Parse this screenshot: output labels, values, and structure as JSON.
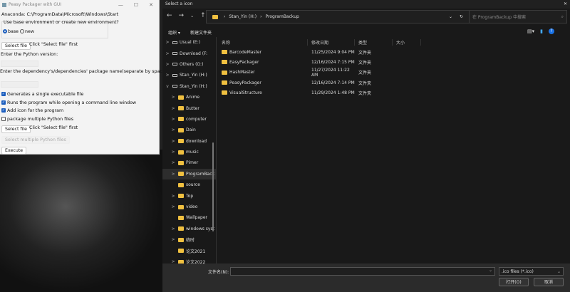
{
  "left_window": {
    "title": "Peasy Packager with GUI",
    "anaconda": "Anaconda: C:\\ProgramData\\Microsoft\\Windows\\Start",
    "env_question": "Use base environment or create new environment?",
    "radio_base": "base",
    "radio_new": "new",
    "select_file": "Select file",
    "select_hint": "Click \"Select file\" first",
    "python_version_label": "Enter the Python version:",
    "deps_label": "Enter the dependency's/dependencies' package name(separate by space):",
    "checks": [
      {
        "label": "Generates a single executable file",
        "checked": true
      },
      {
        "label": "Runs the program while opening a command line window",
        "checked": true
      },
      {
        "label": "Add icon for the program",
        "checked": true
      },
      {
        "label": "package multiple Python files",
        "checked": false
      }
    ],
    "select_file2": "Select file",
    "select_hint2": "Click \"Select file\" first",
    "select_multiple": "Select multiple Python files",
    "execute": "Execute"
  },
  "dialog": {
    "title": "Select a icon",
    "breadcrumb": [
      "Stan_Yin (H:)",
      "ProgramBackup"
    ],
    "search_placeholder": "在 ProgramBackup 中搜索",
    "organize": "组织 ▾",
    "new_folder": "新建文件夹",
    "nav": [
      {
        "label": "Usual (E:)",
        "exp": ">",
        "drive": true
      },
      {
        "label": "Download (F:",
        "exp": ">",
        "drive": true
      },
      {
        "label": "Others (G:)",
        "exp": ">",
        "drive": true
      },
      {
        "label": "Stan_Yin (H:)",
        "exp": ">",
        "drive": true
      },
      {
        "label": "Stan_Yin (H:)",
        "exp": "v",
        "drive": true
      },
      {
        "label": "Anime",
        "exp": ">"
      },
      {
        "label": "Butter",
        "exp": ">"
      },
      {
        "label": "computer",
        "exp": ">"
      },
      {
        "label": "Dain",
        "exp": ">"
      },
      {
        "label": "download",
        "exp": ">"
      },
      {
        "label": "music",
        "exp": ">"
      },
      {
        "label": "Pimer",
        "exp": ">"
      },
      {
        "label": "ProgramBack",
        "exp": ">",
        "selected": true
      },
      {
        "label": "source",
        "exp": ""
      },
      {
        "label": "Top",
        "exp": ">"
      },
      {
        "label": "video",
        "exp": ">"
      },
      {
        "label": "Wallpaper",
        "exp": ""
      },
      {
        "label": "windows syst",
        "exp": ">"
      },
      {
        "label": "临时",
        "exp": ">"
      },
      {
        "label": "论文2021",
        "exp": ""
      },
      {
        "label": "论文2022",
        "exp": ">"
      }
    ],
    "columns": [
      "名称",
      "修改日期",
      "类型",
      "大小"
    ],
    "files": [
      {
        "name": "BarcodeMaster",
        "date": "11/25/2024 9:04 PM",
        "type": "文件夹"
      },
      {
        "name": "EasyPackager",
        "date": "12/16/2024 7:15 PM",
        "type": "文件夹"
      },
      {
        "name": "HashMaster",
        "date": "11/27/2024 11:22 AM",
        "type": "文件夹"
      },
      {
        "name": "PeasyPackager",
        "date": "12/16/2024 7:14 PM",
        "type": "文件夹"
      },
      {
        "name": "VisualStructure",
        "date": "11/29/2024 1:48 PM",
        "type": "文件夹"
      }
    ],
    "filename_label": "文件名(N):",
    "filename_value": "",
    "filter": ".ico files (*.ico)",
    "open": "打开(O)",
    "cancel": "取消"
  }
}
